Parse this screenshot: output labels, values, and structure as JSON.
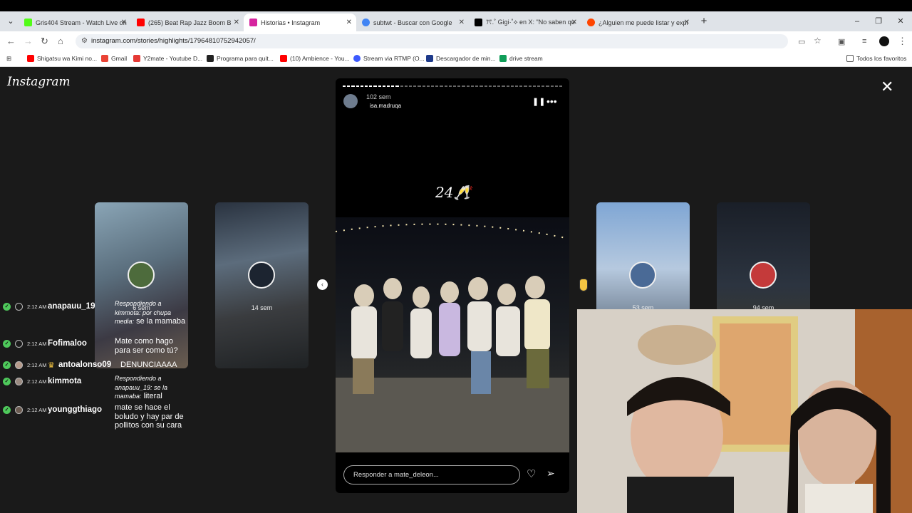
{
  "browser": {
    "tabs": [
      {
        "label": "Gris404 Stream - Watch Live on",
        "color": "#53fc18"
      },
      {
        "label": "(265) Beat Rap Jazz Boom B",
        "color": "#ff0000"
      },
      {
        "label": "Historias • Instagram",
        "color": "#d6249f"
      },
      {
        "label": "subtwt - Buscar con Google",
        "color": "#4285f4"
      },
      {
        "label": "ꔫ.˚ Gigi·˚⟡ en X: \"No saben qu",
        "color": "#000000"
      },
      {
        "label": "¿Alguien me puede listar y expl",
        "color": "#ff4500"
      }
    ],
    "url": "instagram.com/stories/highlights/17964810752942057/",
    "bookmarks": [
      {
        "label": "Shigatsu wa Kimi no...",
        "color": "#ff0000"
      },
      {
        "label": "Gmail",
        "color": "#ea4335"
      },
      {
        "label": "Y2mate - Youtube D...",
        "color": "#e53935"
      },
      {
        "label": "Programa para quit...",
        "color": "#222222"
      },
      {
        "label": "(10) Ambience - You...",
        "color": "#ff0000"
      },
      {
        "label": "Stream via RTMP (O...",
        "color": "#3d5afe"
      },
      {
        "label": "Descargador de min...",
        "color": "#1e3a8a"
      },
      {
        "label": "drive stream",
        "color": "#0f9d58"
      }
    ],
    "bookmarks_folder": "Todos los favoritos"
  },
  "instagram": {
    "logo": "Instagram",
    "story": {
      "time": "102 sem",
      "user": "isa.madruqa",
      "caption": "24🥂",
      "reply_placeholder": "Responder a mate_deleon..."
    },
    "side_stories": [
      {
        "time": "6 sem"
      },
      {
        "time": "14 sem"
      },
      {
        "time": "53 sem"
      },
      {
        "time": "94 sem"
      }
    ]
  },
  "chat": [
    {
      "time": "2:12 AM",
      "user": "anapauu_19",
      "reply_to": "Respondiendo a kimmota: por chupa media:",
      "text": "se la mamaba"
    },
    {
      "time": "2:12 AM",
      "user": "Fofimaloo",
      "reply_to": "",
      "text": "Mate como hago para ser como tú?"
    },
    {
      "time": "2:12 AM",
      "user": "antoalonso09",
      "reply_to": "",
      "text": "DENUNCIAAAA"
    },
    {
      "time": "2:12 AM",
      "user": "kimmota",
      "reply_to": "Respondiendo a anapauu_19: se la mamaba:",
      "text": "literal"
    },
    {
      "time": "2:12 AM",
      "user": "younggthiago",
      "reply_to": "",
      "text": "mate se hace el boludo y hay par de pollitos con su cara"
    }
  ]
}
